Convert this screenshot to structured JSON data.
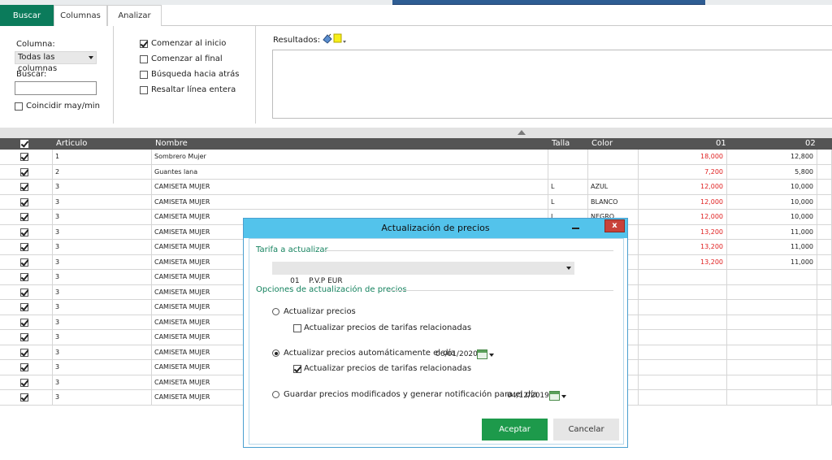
{
  "tabs": [
    {
      "label": "Buscar",
      "active": true
    },
    {
      "label": "Columnas",
      "active": false
    },
    {
      "label": "Analizar",
      "active": false
    }
  ],
  "search": {
    "column_label": "Columna:",
    "column_value": "Todas las columnas",
    "search_label": "Buscar:",
    "search_value": "",
    "match_case_label": "Coincidir may/min",
    "match_case_checked": false
  },
  "options": {
    "start_label": "Comenzar al inicio",
    "end_label": "Comenzar al final",
    "backward_label": "Búsqueda hacia atrás",
    "highlight_label": "Resaltar línea entera"
  },
  "results": {
    "label": "Resultados:",
    "icons": [
      "paint-bucket-icon",
      "highlight-color-icon"
    ]
  },
  "grid": {
    "columns": [
      "Articulo",
      "Nombre",
      "Talla",
      "Color",
      "01",
      "02"
    ],
    "rows": [
      {
        "articulo": "1",
        "nombre": "Sombrero Mujer",
        "talla": "",
        "color": "",
        "p01": "18,000",
        "p02": "12,800"
      },
      {
        "articulo": "2",
        "nombre": "Guantes lana",
        "talla": "",
        "color": "",
        "p01": "7,200",
        "p02": "5,800"
      },
      {
        "articulo": "3",
        "nombre": "CAMISETA MUJER",
        "talla": "L",
        "color": "AZUL",
        "p01": "12,000",
        "p02": "10,000"
      },
      {
        "articulo": "3",
        "nombre": "CAMISETA MUJER",
        "talla": "L",
        "color": "BLANCO",
        "p01": "12,000",
        "p02": "10,000"
      },
      {
        "articulo": "3",
        "nombre": "CAMISETA MUJER",
        "talla": "L",
        "color": "NEGRO",
        "p01": "12,000",
        "p02": "10,000"
      },
      {
        "articulo": "3",
        "nombre": "CAMISETA MUJER",
        "talla": "",
        "color": "",
        "p01": "13,200",
        "p02": "11,000"
      },
      {
        "articulo": "3",
        "nombre": "CAMISETA MUJER",
        "talla": "",
        "color": "",
        "p01": "13,200",
        "p02": "11,000"
      },
      {
        "articulo": "3",
        "nombre": "CAMISETA MUJER",
        "talla": "",
        "color": "",
        "p01": "13,200",
        "p02": "11,000"
      },
      {
        "articulo": "3",
        "nombre": "CAMISETA MUJER",
        "talla": "",
        "color": "",
        "p01": "",
        "p02": ""
      },
      {
        "articulo": "3",
        "nombre": "CAMISETA MUJER",
        "talla": "",
        "color": "",
        "p01": "",
        "p02": ""
      },
      {
        "articulo": "3",
        "nombre": "CAMISETA MUJER",
        "talla": "",
        "color": "",
        "p01": "",
        "p02": ""
      },
      {
        "articulo": "3",
        "nombre": "CAMISETA MUJER",
        "talla": "",
        "color": "",
        "p01": "",
        "p02": ""
      },
      {
        "articulo": "3",
        "nombre": "CAMISETA MUJER",
        "talla": "",
        "color": "",
        "p01": "",
        "p02": ""
      },
      {
        "articulo": "3",
        "nombre": "CAMISETA MUJER",
        "talla": "",
        "color": "",
        "p01": "",
        "p02": ""
      },
      {
        "articulo": "3",
        "nombre": "CAMISETA MUJER",
        "talla": "",
        "color": "",
        "p01": "",
        "p02": ""
      },
      {
        "articulo": "3",
        "nombre": "CAMISETA MUJER",
        "talla": "",
        "color": "",
        "p01": "",
        "p02": ""
      },
      {
        "articulo": "3",
        "nombre": "CAMISETA MUJER",
        "talla": "",
        "color": "",
        "p01": "",
        "p02": ""
      }
    ]
  },
  "dialog": {
    "title": "Actualización de precios",
    "close_glyph": "x",
    "tarifa_section": "Tarifa a actualizar",
    "tarifa_value": "01    P.V.P EUR",
    "options_section": "Opciones de actualización de precios",
    "opt1_label": "Actualizar precios",
    "opt1_related_label": "Actualizar precios de tarifas relacionadas",
    "opt2_label": "Actualizar precios automáticamente el día",
    "opt2_date": "06/01/2020",
    "opt2_related_label": "Actualizar precios de tarifas relacionadas",
    "opt3_label": "Guardar precios modificados y generar notificación para el día",
    "opt3_date": "04/12/2019",
    "accept_label": "Aceptar",
    "cancel_label": "Cancelar"
  },
  "colors": {
    "accent": "#0b7b5b",
    "price_red": "#e02020",
    "dialog_title": "#53c3eb",
    "accept": "#1d9a4b"
  }
}
